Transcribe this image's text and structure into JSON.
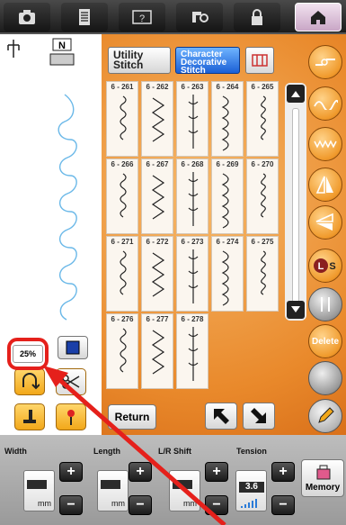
{
  "top_tabs": [
    {
      "name": "camera-icon"
    },
    {
      "name": "document-icon"
    },
    {
      "name": "help-icon"
    },
    {
      "name": "sewing-machine-icon"
    },
    {
      "name": "lock-icon"
    },
    {
      "name": "home-icon"
    }
  ],
  "left_panel": {
    "zoom": "25%"
  },
  "stitch_tabs": {
    "utility": "Utility Stitch",
    "character": "Character Decorative Stitch"
  },
  "stitches": [
    [
      "6 - 261",
      "6 - 262",
      "6 - 263",
      "6 - 264",
      "6 - 265"
    ],
    [
      "6 - 266",
      "6 - 267",
      "6 - 268",
      "6 - 269",
      "6 - 270"
    ],
    [
      "6 - 271",
      "6 - 272",
      "6 - 273",
      "6 - 274",
      "6 - 275"
    ],
    [
      "6 - 276",
      "6 - 277",
      "6 - 278"
    ]
  ],
  "buttons": {
    "return": "Return",
    "delete": "Delete",
    "memory": "Memory"
  },
  "bottom_labels": {
    "width": "Width",
    "length": "Length",
    "lr_shift": "L/R Shift",
    "tension": "Tension"
  },
  "values": {
    "width_unit": "mm",
    "length_unit": "mm",
    "lr_unit": "mm",
    "tension_value": "3.6"
  },
  "colors": {
    "accent_orange": "#e9892b",
    "selected_tab": "#1a5fd6",
    "annotation_red": "#e5201b"
  }
}
